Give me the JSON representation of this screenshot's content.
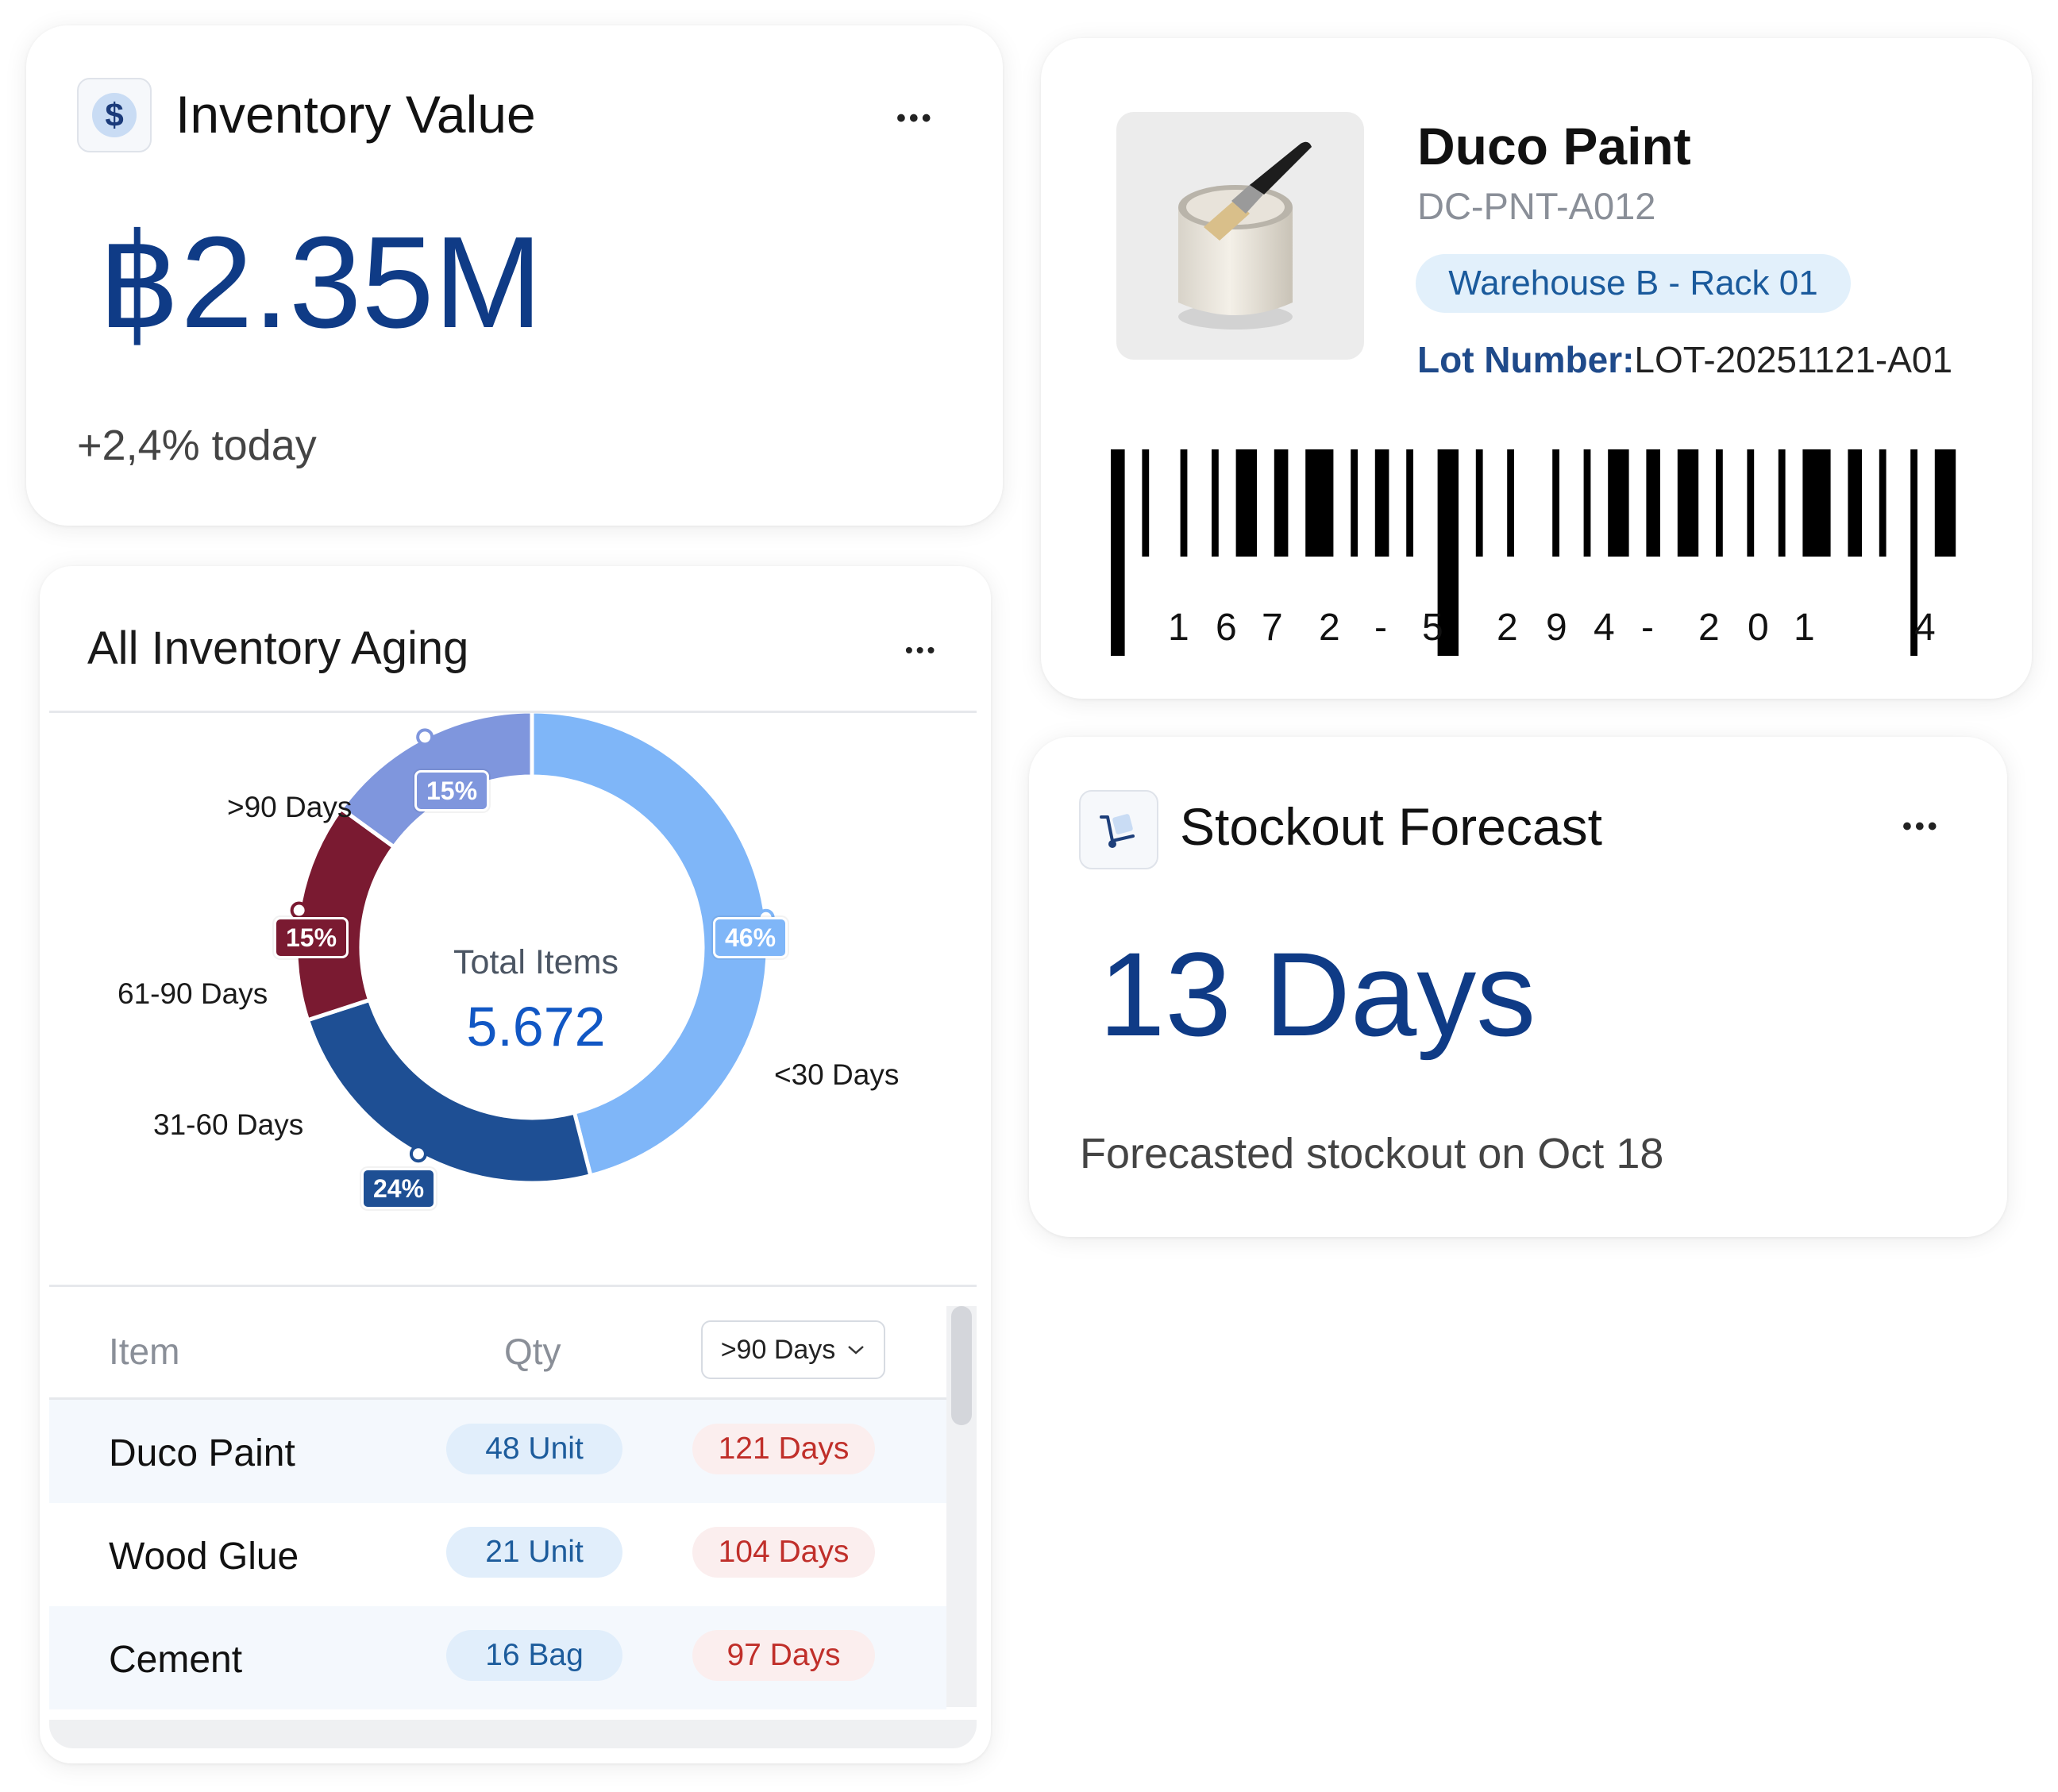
{
  "inventory_value": {
    "title": "Inventory Value",
    "value": "฿2.35M",
    "change": "+2,4% today",
    "icon": "dollar-icon",
    "more": "•••"
  },
  "product": {
    "name": "Duco Paint",
    "sku": "DC-PNT-A012",
    "location": "Warehouse B - Rack 01",
    "lot_label": "Lot Number:",
    "lot_value": "LOT-20251121-A01",
    "barcode_digits": [
      "1",
      "6",
      "7",
      "2",
      "-",
      "5",
      "2",
      "9",
      "4",
      "-",
      "2",
      "0",
      "1",
      "4"
    ]
  },
  "aging": {
    "title": "All Inventory Aging",
    "more": "•••",
    "total_label": "Total Items",
    "total_value": "5.672",
    "chart_data": {
      "type": "pie",
      "title": "All Inventory Aging",
      "categories": [
        "<30 Days",
        "31-60 Days",
        "61-90 Days",
        ">90 Days"
      ],
      "values": [
        46,
        24,
        15,
        15
      ],
      "unit": "%",
      "colors": [
        "#7fb6f8",
        "#1e4f94",
        "#7a1a31",
        "#7f96dd"
      ],
      "badges": [
        "46%",
        "24%",
        "15%",
        "15%"
      ]
    },
    "table": {
      "headers": {
        "item": "Item",
        "qty": "Qty"
      },
      "filter": ">90 Days",
      "rows": [
        {
          "item": "Duco Paint",
          "qty": "48 Unit",
          "days": "121 Days"
        },
        {
          "item": "Wood Glue",
          "qty": "21 Unit",
          "days": "104 Days"
        },
        {
          "item": "Cement",
          "qty": "16 Bag",
          "days": "97 Days"
        }
      ]
    }
  },
  "stockout": {
    "title": "Stockout Forecast",
    "value": "13 Days",
    "subtitle": "Forecasted stockout on Oct 18",
    "icon": "hand-truck-icon",
    "more": "•••"
  }
}
